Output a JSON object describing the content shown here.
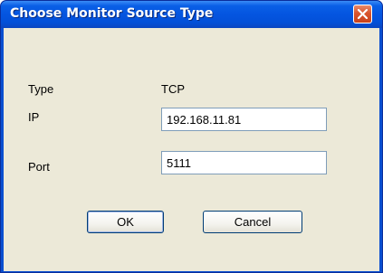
{
  "window": {
    "title": "Choose Monitor Source Type",
    "close_icon": "close-icon"
  },
  "form": {
    "type_label": "Type",
    "type_value": "TCP",
    "ip_label": "IP",
    "ip_value": "192.168.11.81",
    "port_label": "Port",
    "port_value": "5111"
  },
  "buttons": {
    "ok_label": "OK",
    "cancel_label": "Cancel"
  },
  "colors": {
    "titlebar": "#0455e0",
    "client_background": "#ece9d8",
    "close_button": "#d9542c"
  }
}
